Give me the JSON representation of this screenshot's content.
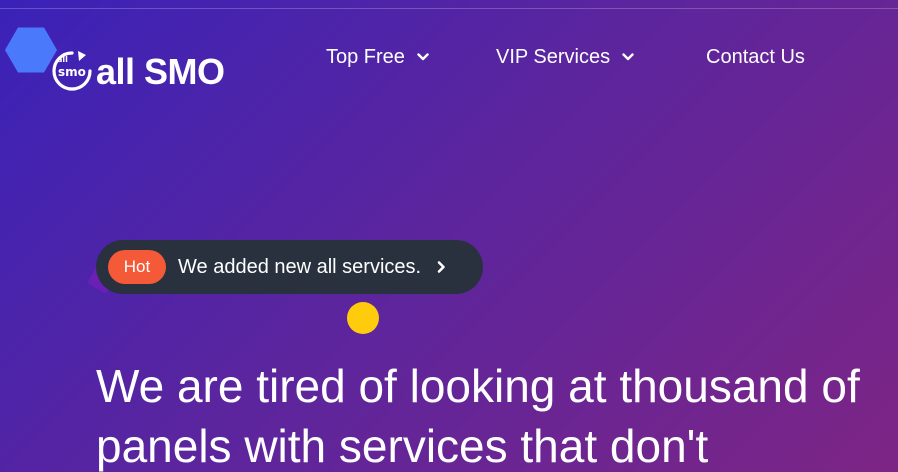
{
  "brand": {
    "logo_small_top": "all",
    "logo_small_bottom": "smo",
    "logo_text": "all SMO"
  },
  "nav": {
    "items": [
      {
        "label": "Top Free",
        "has_dropdown": true,
        "icon": "chevron-down-icon"
      },
      {
        "label": "VIP Services",
        "has_dropdown": true,
        "icon": "chevron-down-icon"
      },
      {
        "label": "Contact Us",
        "has_dropdown": false
      }
    ]
  },
  "announcement": {
    "badge": "Hot",
    "text": "We added new all services.",
    "icon": "chevron-right-icon"
  },
  "hero": {
    "heading": "We are tired of looking at thousand of panels with services that don't"
  },
  "colors": {
    "background_start": "#3a22b8",
    "background_end": "#7d2585",
    "hot_badge": "#f45a37",
    "pill_bg": "#29313f",
    "accent_dot": "#ffcc0d",
    "logo_hexagon": "#4b7fff"
  }
}
